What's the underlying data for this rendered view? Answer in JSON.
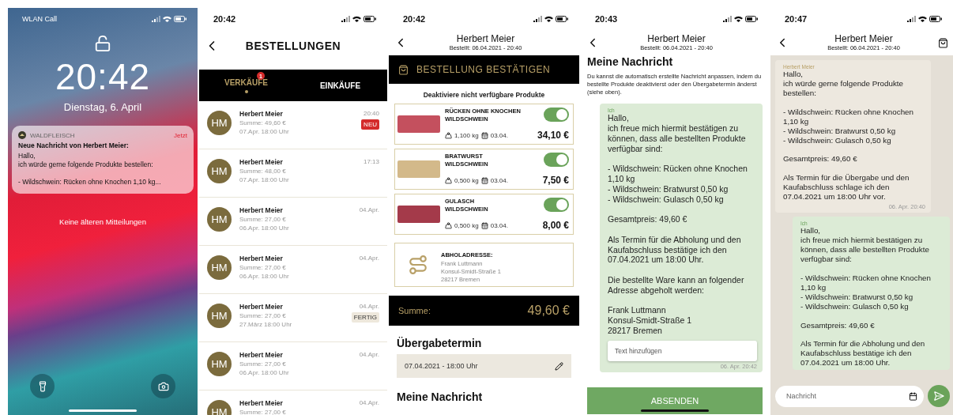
{
  "lock_screen": {
    "carrier": "WLAN Call",
    "time": "20:42",
    "date": "Dienstag, 6. April",
    "notification": {
      "app": "WALDFLEISCH",
      "when": "Jetzt",
      "title": "Neue Nachricht von Herbert Meier:",
      "body": "Hallo,\nich würde gerne folgende Produkte bestellen:\n\n- Wildschwein: Rücken ohne Knochen 1,10 kg..."
    },
    "footer": "Keine älteren Mitteilungen"
  },
  "orders_screen": {
    "time": "20:42",
    "title": "BESTELLUNGEN",
    "tabs": [
      {
        "label": "VERKÄUFE",
        "selected": true,
        "badge": "1"
      },
      {
        "label": "EINKÄUFE",
        "selected": false
      }
    ],
    "orders": [
      {
        "initials": "HM",
        "name": "Herbert Meier",
        "sum": "Summe: 49,60 €",
        "pickup": "07.Apr. 18:00 Uhr",
        "time": "20:40",
        "status": {
          "label": "NEU",
          "kind": "new"
        }
      },
      {
        "initials": "HM",
        "name": "Herbert Meier",
        "sum": "Summe: 48,00 €",
        "pickup": "07.Apr. 18:00 Uhr",
        "time": "17:13"
      },
      {
        "initials": "HM",
        "name": "Herbert Meier",
        "sum": "Summe: 27,00 €",
        "pickup": "06.Apr. 18:00 Uhr",
        "time": "04.Apr."
      },
      {
        "initials": "HM",
        "name": "Herbert Meier",
        "sum": "Summe: 27,00 €",
        "pickup": "06.Apr. 18:00 Uhr",
        "time": "04.Apr."
      },
      {
        "initials": "HM",
        "name": "Herbert Meier",
        "sum": "Summe: 27,00 €",
        "pickup": "27.März 18:00 Uhr",
        "time": "04.Apr.",
        "status": {
          "label": "FERTIG",
          "kind": "done"
        }
      },
      {
        "initials": "HM",
        "name": "Herbert Meier",
        "sum": "Summe: 27,00 €",
        "pickup": "06.Apr. 18:00 Uhr",
        "time": "04.Apr."
      },
      {
        "initials": "HM",
        "name": "Herbert Meier",
        "sum": "Summe: 27,00 €",
        "time": "04.Apr."
      }
    ]
  },
  "detail_screen": {
    "time": "20:42",
    "customer": "Herbert Meier",
    "ordered": "Bestellt: 06.04.2021 - 20:40",
    "confirm": "BESTELLUNG BESTÄTIGEN",
    "hint": "Deaktiviere nicht verfügbare Produkte",
    "products": [
      {
        "name": "RÜCKEN OHNE KNOCHEN\nWILDSCHWEIN",
        "weight": "1,100 kg",
        "date": "03.04.",
        "price": "34,10 €",
        "on": true
      },
      {
        "name": "BRATWURST\nWILDSCHWEIN",
        "weight": "0,500 kg",
        "date": "03.04.",
        "price": "7,50 €",
        "on": true
      },
      {
        "name": "GULASCH\nWILDSCHWEIN",
        "weight": "0,500 kg",
        "date": "03.04.",
        "price": "8,00 €",
        "on": true
      }
    ],
    "address": {
      "label": "ABHOLADRESSE:",
      "text": "Frank Luttmann\nKonsul-Smidt-Straße 1\n28217 Bremen"
    },
    "sum": {
      "label": "Summe:",
      "value": "49,60 €"
    },
    "handover": {
      "title": "Übergabetermin",
      "value": "07.04.2021 - 18:00 Uhr"
    },
    "message_title": "Meine Nachricht"
  },
  "message_screen": {
    "time": "20:43",
    "customer": "Herbert Meier",
    "ordered": "Bestellt: 06.04.2021 - 20:40",
    "title": "Meine Nachricht",
    "description": "Du kannst die automatisch erstellte Nachricht anpassen, indem du bestellte Produkte deaktivierst oder den Übergabetermin änderst (siehe oben).",
    "message": {
      "sender": "Ich",
      "text": "Hallo,\nich freue mich hiermit bestätigen zu können, dass alle bestellten Produkte verfügbar sind:\n\n- Wildschwein: Rücken ohne Knochen 1,10 kg\n- Wildschwein: Bratwurst 0,50 kg\n- Wildschwein: Gulasch 0,50 kg\n\nGesamtpreis: 49,60 €\n\nAls Termin für die Abholung und den Kaufabschluss bestätige ich den 07.04.2021 um 18:00 Uhr.\n\nDie bestellte Ware kann an folgender Adresse abgeholt werden:\n\nFrank Luttmann\nKonsul-Smidt-Straße 1\n28217 Bremen",
      "time": "06. Apr. 20:42"
    },
    "input_placeholder": "Text hinzufügen",
    "send": "ABSENDEN"
  },
  "chat_screen": {
    "time": "20:47",
    "customer": "Herbert Meier",
    "ordered": "Bestellt: 06.04.2021 - 20:40",
    "messages": [
      {
        "kind": "incoming",
        "sender": "Herbert Meier",
        "text": "Hallo,\nich würde gerne folgende Produkte bestellen:\n\n- Wildschwein: Rücken ohne Knochen 1,10 kg\n- Wildschwein: Bratwurst 0,50 kg\n- Wildschwein: Gulasch 0,50 kg\n\nGesamtpreis: 49,60 €\n\nAls Termin für die Übergabe und den Kaufabschluss schlage ich den 07.04.2021 um 18:00 Uhr vor.",
        "time": "06. Apr. 20:40"
      },
      {
        "kind": "outgoing",
        "sender": "Ich",
        "text": "Hallo,\nich freue mich hiermit bestätigen zu können, dass alle bestellten Produkte verfügbar sind:\n\n- Wildschwein: Rücken ohne Knochen 1,10 kg\n- Wildschwein: Bratwurst 0,50 kg\n- Wildschwein: Gulasch 0,50 kg\n\nGesamtpreis: 49,60 €\n\nAls Termin für die Abholung und den Kaufabschluss bestätige ich den 07.04.2021 um 18:00 Uhr."
      }
    ],
    "input_placeholder": "Nachricht"
  }
}
